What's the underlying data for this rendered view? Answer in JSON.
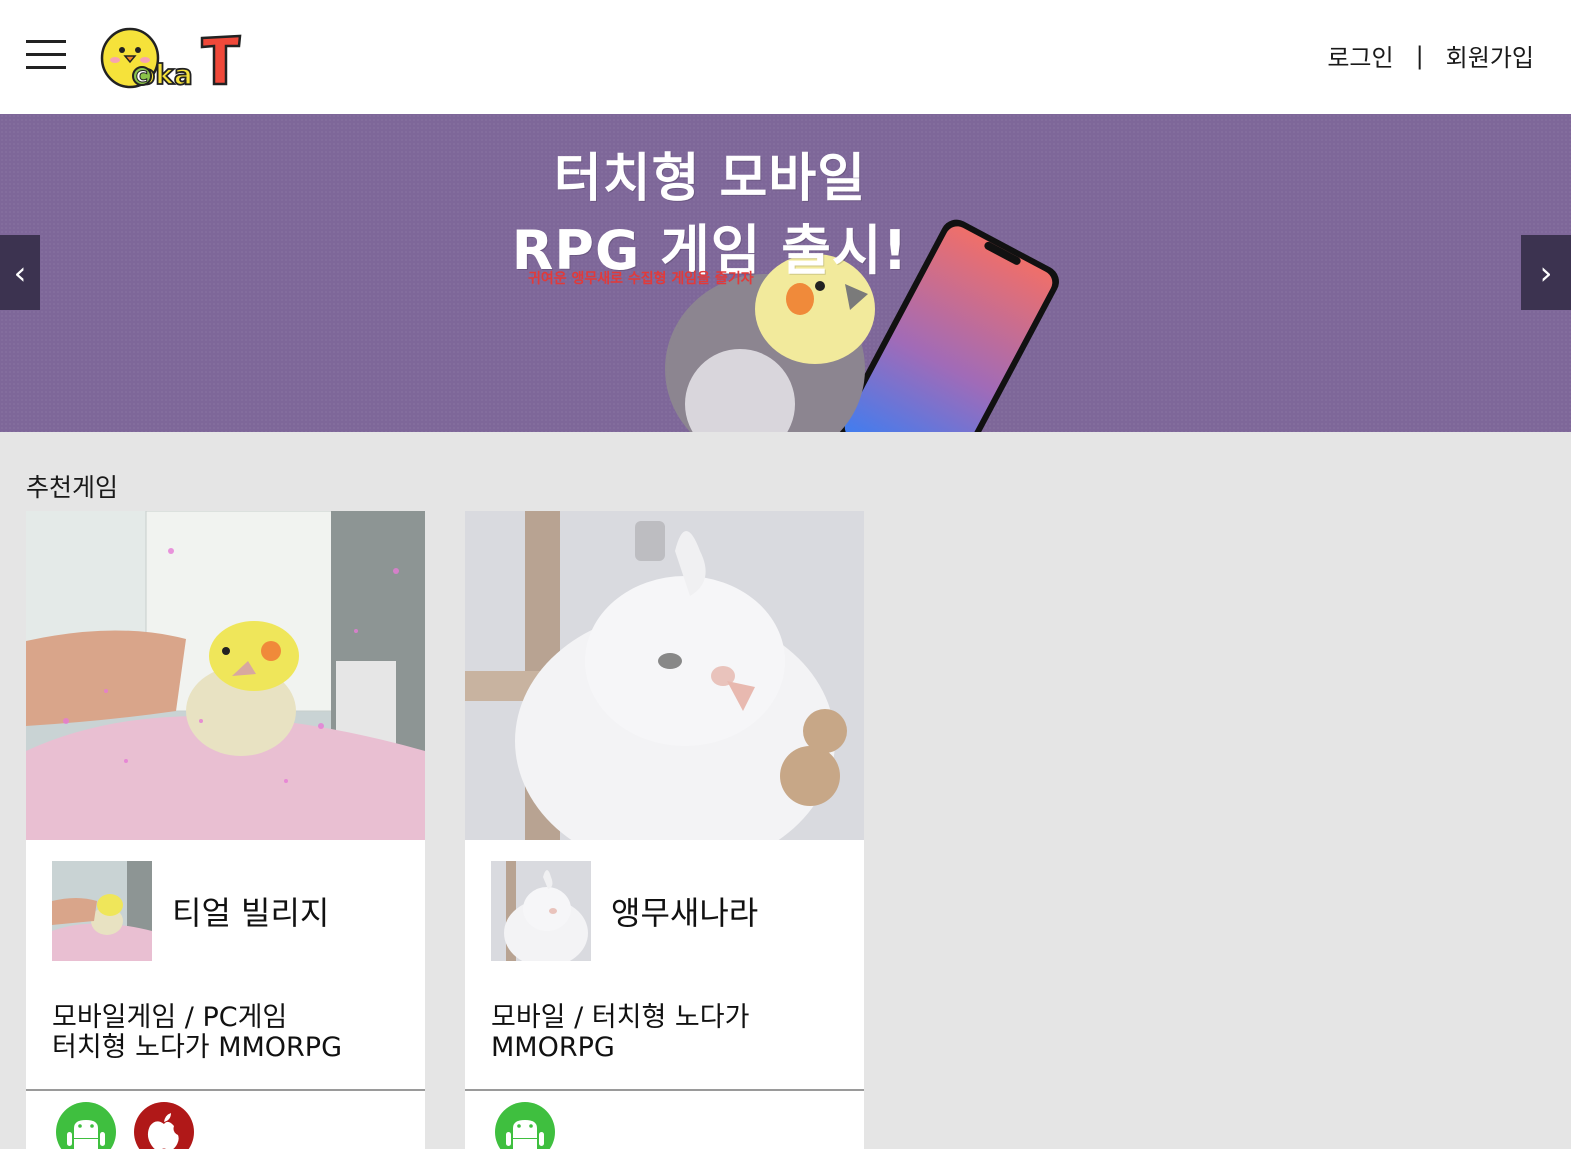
{
  "header": {
    "menu_icon": "hamburger-menu-icon",
    "logo_text": "CokaT",
    "login_label": "로그인",
    "separator": "|",
    "signup_label": "회원가입"
  },
  "banner": {
    "title_line1": "터치형 모바일",
    "title_line2": "RPG 게임 출시!",
    "subtitle": "귀여운 앵무새로 수집형 게임을 즐기자",
    "prev_label": "‹",
    "next_label": "›",
    "background_color": "#7e6799"
  },
  "section": {
    "title": "추천게임"
  },
  "games": [
    {
      "name": "티얼 빌리지",
      "desc_line1": "모바일게임 / PC게임",
      "desc_line2": "터치형 노다가 MMORPG",
      "platforms": [
        "android-icon",
        "apple-icon"
      ]
    },
    {
      "name": "앵무새나라",
      "desc_line1": "모바일 / 터치형 노다가",
      "desc_line2": "MMORPG",
      "platforms": [
        "android-icon"
      ]
    }
  ],
  "colors": {
    "android": "#3fbf3f",
    "apple": "#b01818",
    "page_bg": "#e5e5e5"
  }
}
